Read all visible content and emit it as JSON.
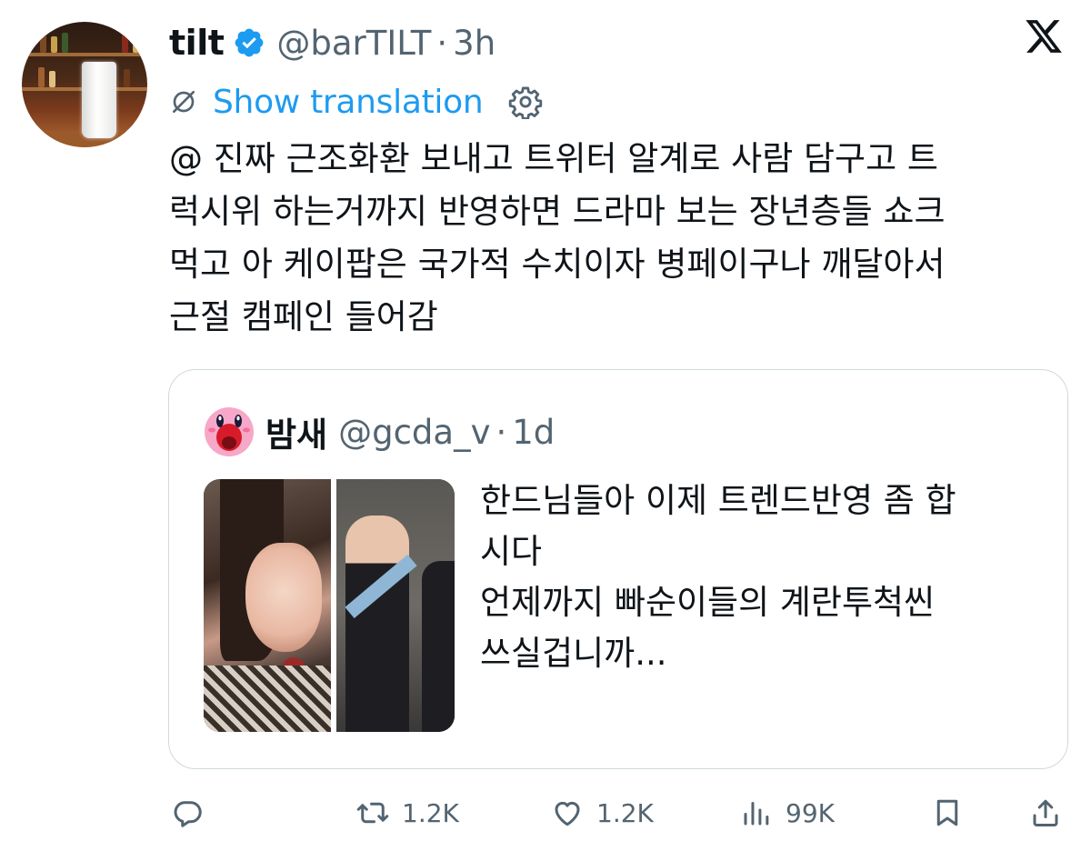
{
  "tweet": {
    "display_name": "tilt",
    "verified": true,
    "handle": "@barTILT",
    "separator": "·",
    "time": "3h",
    "show_translation_label": "Show translation",
    "text": "@ 진짜 근조화환 보내고 트위터 알계로 사람 담구고 트\n럭시위 하는거까지 반영하면 드라마 보는 장년층들 쇼크\n먹고 아 케이팝은 국가적 수치이자 병페이구나 깨달아서\n근절 캠페인 들어감"
  },
  "quote": {
    "display_name": "밤새",
    "handle": "@gcda_v",
    "separator": "·",
    "time": "1d",
    "text": "한드님들아 이제 트렌드반영 좀 합\n시다\n언제까지 빠순이들의 계란투척씬\n쓰실겁니까..."
  },
  "actions": {
    "reply_count": "",
    "retweet_count": "1.2K",
    "like_count": "1.2K",
    "views_count": "99K"
  },
  "colors": {
    "accent": "#1d9bf0",
    "secondary_text": "#536471",
    "border": "#cfd9de",
    "verified": "#1d9bf0"
  },
  "icons": [
    "verified-badge-icon",
    "x-logo-icon",
    "translate-icon",
    "gear-icon",
    "reply-icon",
    "retweet-icon",
    "like-icon",
    "views-icon",
    "bookmark-icon",
    "share-icon"
  ]
}
